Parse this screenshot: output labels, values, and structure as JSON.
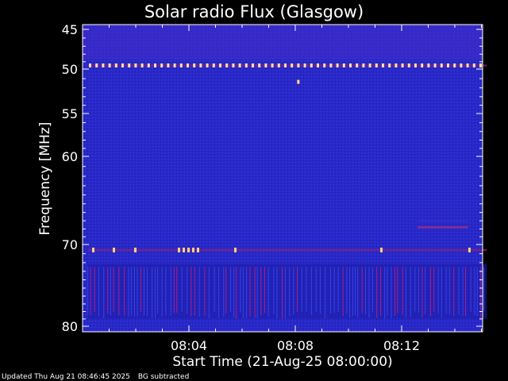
{
  "chart_data": {
    "type": "heatmap",
    "title": "Solar radio Flux (Glasgow)",
    "xlabel": "Start Time (21-Aug-25 08:00:00)",
    "ylabel": "Frequency [MHz]",
    "x_unit": "minutes after 08:00:00",
    "xlim": [
      0,
      15.2
    ],
    "ylim": [
      45,
      80
    ],
    "y_ticks": [
      45,
      50,
      55,
      60,
      70,
      80
    ],
    "x_ticks": [
      {
        "value": 4,
        "label": "08:04"
      },
      {
        "value": 8,
        "label": "08:08"
      },
      {
        "value": 12,
        "label": "08:12"
      }
    ],
    "background_color": "#2a2ad0",
    "features": [
      {
        "name": "interference line",
        "frequency": 49.5,
        "x_range": [
          0.2,
          15.2
        ]
      },
      {
        "name": "interference line",
        "frequency": 70.6,
        "x_range": [
          0.2,
          15.2
        ]
      },
      {
        "name": "point",
        "frequency": 51.3,
        "x_range": [
          8.1,
          8.2
        ]
      },
      {
        "name": "weak band",
        "frequency": 67.8,
        "x_range": [
          12.6,
          14.5
        ]
      },
      {
        "name": "striped region",
        "frequency_range": [
          72.5,
          79.0
        ],
        "x_range": [
          0.2,
          15.2
        ]
      }
    ]
  },
  "footer": {
    "updated": "Updated Thu Aug 21 08:46:45 2025",
    "note": "BG subtracted"
  }
}
